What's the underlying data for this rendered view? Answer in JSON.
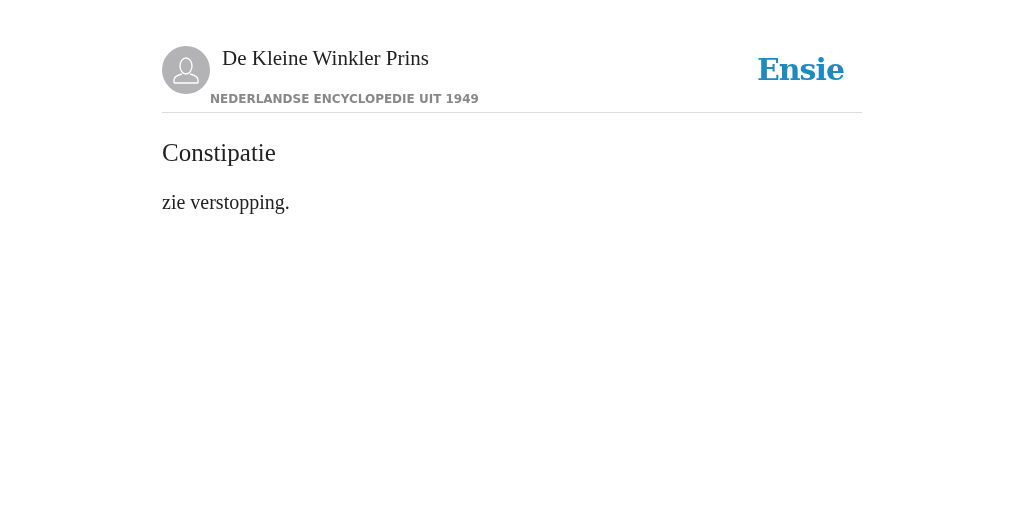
{
  "header": {
    "title": "De Kleine Winkler Prins",
    "subtitle": "NEDERLANDSE ENCYCLOPEDIE UIT 1949",
    "logo": "Ensie"
  },
  "article": {
    "title": "Constipatie",
    "body": "zie verstopping."
  }
}
